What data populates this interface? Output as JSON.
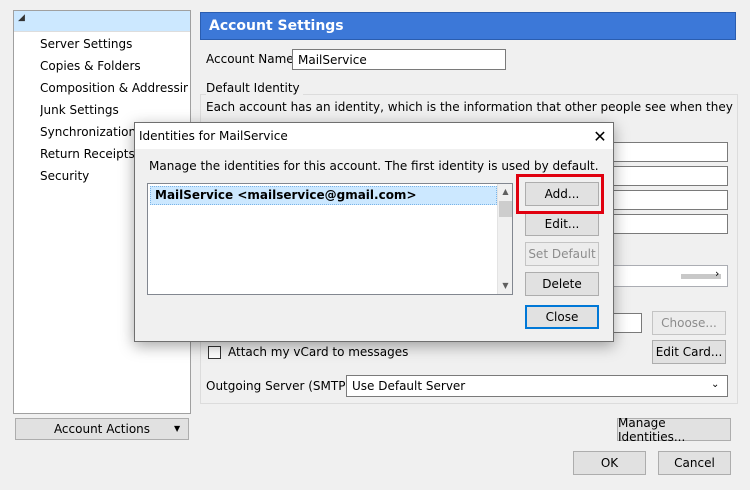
{
  "left_nav": {
    "items": [
      "Server Settings",
      "Copies & Folders",
      "Composition & Addressing",
      "Junk Settings",
      "Synchronization & Storage",
      "Return Receipts",
      "Security"
    ],
    "account_actions_label": "Account Actions"
  },
  "settings": {
    "header": "Account Settings",
    "account_name_label": "Account Name:",
    "account_name_value": "MailService",
    "default_identity_legend": "Default Identity",
    "identity_description": "Each account has an identity, which is the information that other people see when they read your messages.",
    "choose_label": "Choose...",
    "attach_vcard_label": "Attach my vCard to messages",
    "edit_card_label": "Edit Card...",
    "outgoing_server_label": "Outgoing Server (SMTP):",
    "outgoing_server_value": "Use Default Server",
    "manage_identities_label": "Manage Identities...",
    "ok_label": "OK",
    "cancel_label": "Cancel"
  },
  "dialog": {
    "title": "Identities for MailService",
    "description": "Manage the identities for this account. The first identity is used by default.",
    "identities": [
      "MailService <mailservice@gmail.com>"
    ],
    "add_label": "Add...",
    "edit_label": "Edit...",
    "set_default_label": "Set Default",
    "delete_label": "Delete",
    "close_label": "Close"
  },
  "colors": {
    "header_bg": "#3c78d8",
    "selection_bg": "#cce8ff",
    "highlight_red": "#e0000f",
    "focus_blue": "#0078d7"
  }
}
